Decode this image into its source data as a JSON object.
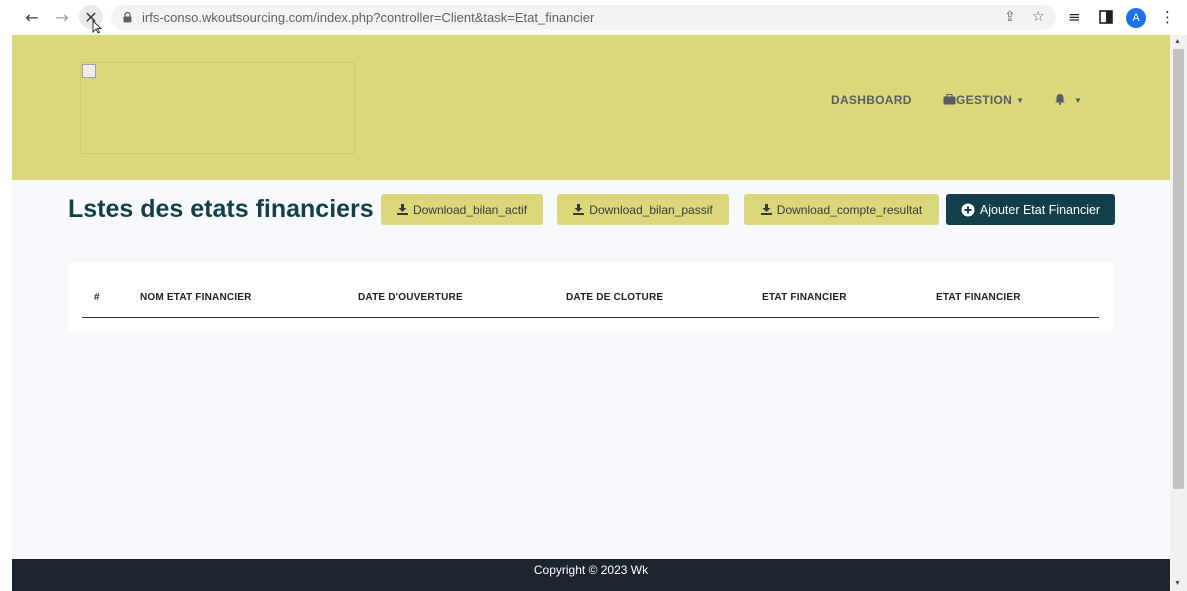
{
  "browser": {
    "url": "irfs-conso.wkoutsourcing.com/index.php?controller=Client&task=Etat_financier",
    "avatar_letter": "A"
  },
  "navbar": {
    "dashboard_label": "DASHBOARD",
    "gestion_label": "GESTION"
  },
  "page": {
    "title": "Lstes des etats financiers"
  },
  "actions": {
    "download_bilan_actif": "Download_bilan_actif",
    "download_bilan_passif": "Download_bilan_passif",
    "download_compte_resultat": "Download_compte_resultat",
    "add_label": "Ajouter Etat Financier"
  },
  "table": {
    "columns": [
      "#",
      "NOM ETAT FINANCIER",
      "DATE D'OUVERTURE",
      "DATE DE CLOTURE",
      "ETAT FINANCIER",
      "ETAT FINANCIER"
    ]
  },
  "footer": {
    "copyright": "Copyright © 2023 Wk"
  },
  "colors": {
    "header_bg": "#dbd87c",
    "primary": "#123f49",
    "footer_bg": "#1c252e",
    "page_bg": "#f8f9fc"
  }
}
